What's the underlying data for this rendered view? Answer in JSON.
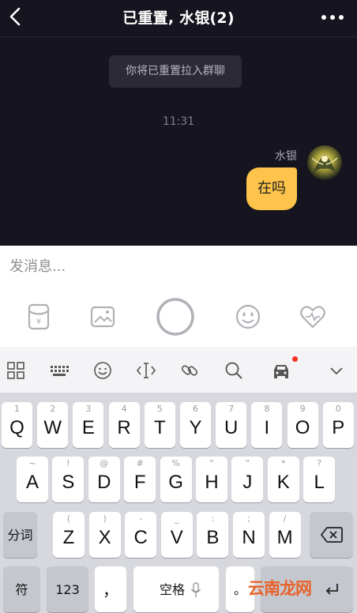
{
  "nav": {
    "title": "已重置, 水银(2)"
  },
  "chat": {
    "notice": "你将已重置拉入群聊",
    "timestamp": "11:31",
    "message": {
      "sender": "水银",
      "text": "在吗"
    }
  },
  "input": {
    "placeholder": "发消息..."
  },
  "keyboard": {
    "row1": [
      {
        "hint": "1",
        "key": "Q"
      },
      {
        "hint": "2",
        "key": "W"
      },
      {
        "hint": "3",
        "key": "E"
      },
      {
        "hint": "4",
        "key": "R"
      },
      {
        "hint": "5",
        "key": "T"
      },
      {
        "hint": "6",
        "key": "Y"
      },
      {
        "hint": "7",
        "key": "U"
      },
      {
        "hint": "8",
        "key": "I"
      },
      {
        "hint": "9",
        "key": "O"
      },
      {
        "hint": "0",
        "key": "P"
      }
    ],
    "row2": [
      {
        "hint": "~",
        "key": "A"
      },
      {
        "hint": "!",
        "key": "S"
      },
      {
        "hint": "@",
        "key": "D"
      },
      {
        "hint": "#",
        "key": "F"
      },
      {
        "hint": "%",
        "key": "G"
      },
      {
        "hint": "“",
        "key": "H"
      },
      {
        "hint": "”",
        "key": "J"
      },
      {
        "hint": "*",
        "key": "K"
      },
      {
        "hint": "?",
        "key": "L"
      }
    ],
    "row3": [
      {
        "hint": "(",
        "key": "Z"
      },
      {
        "hint": ")",
        "key": "X"
      },
      {
        "hint": "-",
        "key": "C"
      },
      {
        "hint": "_",
        "key": "V"
      },
      {
        "hint": ":",
        "key": "B"
      },
      {
        "hint": ";",
        "key": "N"
      },
      {
        "hint": "/",
        "key": "M"
      }
    ],
    "fenci": "分词",
    "fu": "符",
    "num": "123",
    "comma": "，",
    "space": "空格",
    "period": "。"
  },
  "watermark": "云南龙网",
  "colors": {
    "chat_bg": "#16151f",
    "bubble": "#fdc34a",
    "badge": "#f2321e"
  }
}
